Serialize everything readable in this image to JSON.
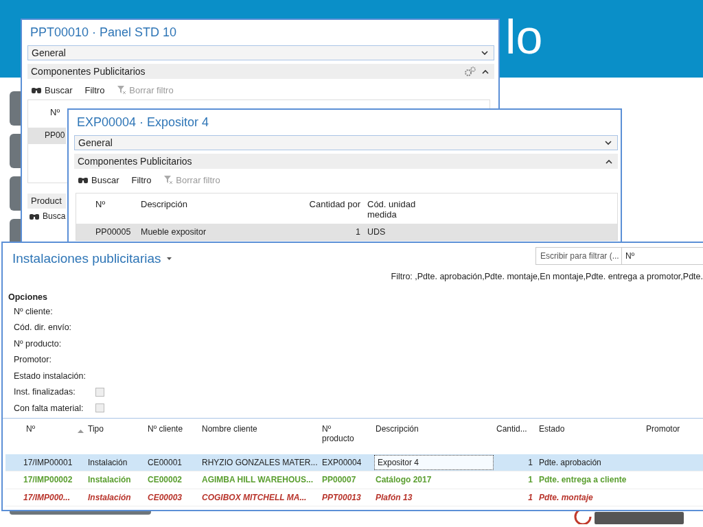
{
  "slide": {
    "title": "lo"
  },
  "window_panel": {
    "title": "PPT00010 · Panel STD 10",
    "fasttabs": [
      {
        "label": "General",
        "expanded": false
      },
      {
        "label": "Componentes Publicitarios",
        "expanded": true
      }
    ],
    "toolbar": [
      "Buscar",
      "Filtro",
      "Borrar filtro"
    ],
    "list": {
      "column": "Nº",
      "row": "PP00"
    },
    "products": {
      "label": "Product",
      "toolbar": "Busca"
    }
  },
  "window_expositor": {
    "title": "EXP00004 · Expositor 4",
    "fasttabs": [
      {
        "label": "General",
        "expanded": false
      },
      {
        "label": "Componentes Publicitarios",
        "expanded": true
      }
    ],
    "toolbar": [
      "Buscar",
      "Filtro",
      "Borrar filtro"
    ],
    "columns": [
      "Nº",
      "Descripción",
      "Cantidad por",
      "Cód. unidad medida"
    ],
    "rows": [
      {
        "cells": [
          "PP00005",
          "Mueble expositor",
          "1",
          "UDS"
        ],
        "selected": true
      }
    ]
  },
  "window_installations": {
    "title": "Instalaciones publicitarias",
    "search": {
      "placeholder": "Escribir para filtrar (...",
      "field": "Nº"
    },
    "filter": "Filtro:  ,Pdte. aprobación,Pdte. montaje,En montaje,Pdte. entrega a promotor,Pdte.",
    "options": {
      "heading": "Opciones",
      "fields": [
        {
          "label": "Nº cliente:",
          "kind": "text"
        },
        {
          "label": "Cód. dir. envío:",
          "kind": "text"
        },
        {
          "label": "Nº producto:",
          "kind": "text"
        },
        {
          "label": "Promotor:",
          "kind": "text"
        },
        {
          "label": "Estado instalación:",
          "kind": "text"
        },
        {
          "label": "Inst. finalizadas:",
          "kind": "checkbox",
          "checked": false
        },
        {
          "label": "Con falta material:",
          "kind": "checkbox",
          "checked": false
        }
      ]
    },
    "columns": [
      "Nº",
      "Tipo",
      "Nº cliente",
      "Nombre cliente",
      "Nº producto",
      "Descripción",
      "Cantid...",
      "Estado",
      "Promotor"
    ],
    "rows": [
      {
        "cells": [
          "17/IMP00001",
          "Instalación",
          "CE00001",
          "RHYZIO GONZALES MATER...",
          "EXP00004",
          "Expositor 4",
          "1",
          "Pdte. aprobación"
        ],
        "selected": true,
        "color": "#222222",
        "bold": false,
        "italic": false
      },
      {
        "cells": [
          "17/IMP00002",
          "Instalación",
          "CE00002",
          "AGIMBA HILL WAREHOUS...",
          "PP00007",
          "Catálogo 2017",
          "1",
          "Pdte. entrega a cliente"
        ],
        "selected": false,
        "color": "#5a9e2f",
        "bold": true,
        "italic": false
      },
      {
        "cells": [
          "17/IMP000...",
          "Instalación",
          "CE00003",
          "COGIBOX MITCHELL MA...",
          "PPT00013",
          "Plafón 13",
          "1",
          "Pdte. montaje"
        ],
        "selected": false,
        "color": "#b8332a",
        "bold": true,
        "italic": true
      }
    ]
  }
}
